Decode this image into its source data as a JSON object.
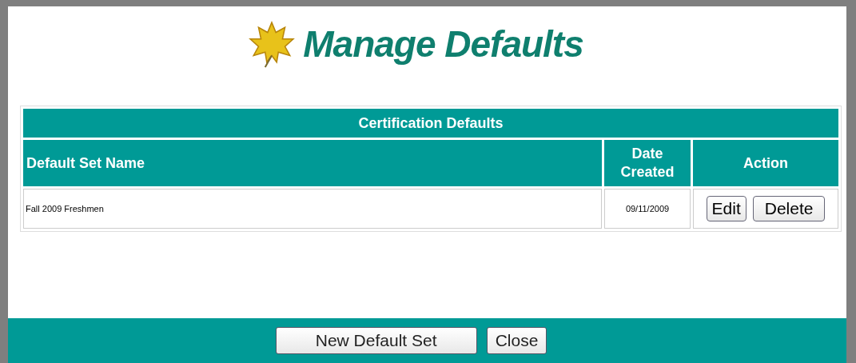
{
  "title": "Manage Defaults",
  "table": {
    "caption": "Certification Defaults",
    "columns": [
      "Default Set Name",
      "Date Created",
      "Action"
    ],
    "rows": [
      {
        "name": "Fall 2009 Freshmen",
        "date": "09/11/2009",
        "actions": [
          "Edit",
          "Delete"
        ]
      }
    ]
  },
  "footer_buttons": [
    "New Default Set",
    "Close"
  ]
}
